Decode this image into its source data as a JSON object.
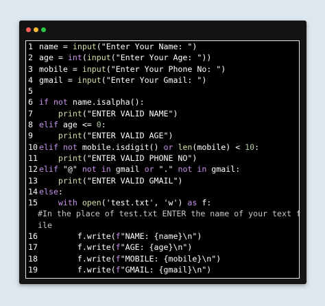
{
  "window": {
    "traffic_colors": [
      "#ff5f57",
      "#febc2e",
      "#28c840"
    ],
    "accent": "#c792ea"
  },
  "lines": [
    {
      "num": "1",
      "tokens": [
        {
          "t": "name = ",
          "c": "txt"
        },
        {
          "t": "input",
          "c": "fn"
        },
        {
          "t": "(\"Enter Your Name: \")",
          "c": "txt"
        }
      ]
    },
    {
      "num": "2",
      "tokens": [
        {
          "t": "age = ",
          "c": "txt"
        },
        {
          "t": "int",
          "c": "kw"
        },
        {
          "t": "(",
          "c": "txt"
        },
        {
          "t": "input",
          "c": "fn"
        },
        {
          "t": "(\"Enter Your Age: \"))",
          "c": "txt"
        }
      ]
    },
    {
      "num": "3",
      "tokens": [
        {
          "t": "mobile = ",
          "c": "txt"
        },
        {
          "t": "input",
          "c": "fn"
        },
        {
          "t": "(\"Enter Your Phone No: \")",
          "c": "txt"
        }
      ]
    },
    {
      "num": "4",
      "tokens": [
        {
          "t": "gmail = ",
          "c": "txt"
        },
        {
          "t": "input",
          "c": "fn"
        },
        {
          "t": "(\"Enter Your Gmail: \")",
          "c": "txt"
        }
      ]
    },
    {
      "num": "5",
      "tokens": []
    },
    {
      "num": "6",
      "tokens": [
        {
          "t": "if not",
          "c": "kw"
        },
        {
          "t": " name.isalpha():",
          "c": "txt"
        }
      ]
    },
    {
      "num": "7",
      "tokens": [
        {
          "t": "    print",
          "c": "fn"
        },
        {
          "t": "(\"ENTER VALID NAME\")",
          "c": "txt"
        }
      ]
    },
    {
      "num": "8",
      "tokens": [
        {
          "t": "elif",
          "c": "kw"
        },
        {
          "t": " age <= ",
          "c": "txt"
        },
        {
          "t": "0",
          "c": "num"
        },
        {
          "t": ":",
          "c": "txt"
        }
      ]
    },
    {
      "num": "9",
      "tokens": [
        {
          "t": "    print",
          "c": "fn"
        },
        {
          "t": "(\"ENTER VALID AGE\")",
          "c": "txt"
        }
      ]
    },
    {
      "num": "10",
      "tokens": [
        {
          "t": "elif not",
          "c": "kw"
        },
        {
          "t": " mobile.isdigit() ",
          "c": "txt"
        },
        {
          "t": "or",
          "c": "kw"
        },
        {
          "t": " ",
          "c": "txt"
        },
        {
          "t": "len",
          "c": "fn"
        },
        {
          "t": "(mobile) < ",
          "c": "txt"
        },
        {
          "t": "10",
          "c": "num"
        },
        {
          "t": ":",
          "c": "txt"
        }
      ]
    },
    {
      "num": "11",
      "tokens": [
        {
          "t": "    print",
          "c": "fn"
        },
        {
          "t": "(\"ENTER VALID PHONE NO\")",
          "c": "txt"
        }
      ]
    },
    {
      "num": "12",
      "tokens": [
        {
          "t": "elif",
          "c": "kw"
        },
        {
          "t": " \"@\" ",
          "c": "txt"
        },
        {
          "t": "not in",
          "c": "kw"
        },
        {
          "t": " gmail ",
          "c": "txt"
        },
        {
          "t": "or",
          "c": "kw"
        },
        {
          "t": " \".\" ",
          "c": "txt"
        },
        {
          "t": "not in",
          "c": "kw"
        },
        {
          "t": " gmail:",
          "c": "txt"
        }
      ]
    },
    {
      "num": "13",
      "tokens": [
        {
          "t": "    print",
          "c": "fn"
        },
        {
          "t": "(\"ENTER VALID GMAIL\")",
          "c": "txt"
        }
      ]
    },
    {
      "num": "14",
      "tokens": [
        {
          "t": "else",
          "c": "kw"
        },
        {
          "t": ":",
          "c": "txt"
        }
      ]
    },
    {
      "num": "15",
      "tokens": [
        {
          "t": "    ",
          "c": "txt"
        },
        {
          "t": "with",
          "c": "kw"
        },
        {
          "t": " ",
          "c": "txt"
        },
        {
          "t": "open",
          "c": "fn"
        },
        {
          "t": "('test.txt', 'w') ",
          "c": "txt"
        },
        {
          "t": "as",
          "c": "kw"
        },
        {
          "t": " f:",
          "c": "txt"
        }
      ]
    },
    {
      "num": "",
      "comment": "#In the place of test.txt ENTER the name of your text f"
    },
    {
      "num": "",
      "comment": "ile"
    },
    {
      "num": "16",
      "tokens": [
        {
          "t": "        f.write(",
          "c": "txt"
        },
        {
          "t": "f",
          "c": "kw"
        },
        {
          "t": "\"NAME: {name}\\n\")",
          "c": "txt"
        }
      ]
    },
    {
      "num": "17",
      "tokens": [
        {
          "t": "        f.write(",
          "c": "txt"
        },
        {
          "t": "f",
          "c": "kw"
        },
        {
          "t": "\"AGE: {age}\\n\")",
          "c": "txt"
        }
      ]
    },
    {
      "num": "18",
      "tokens": [
        {
          "t": "        f.write(",
          "c": "txt"
        },
        {
          "t": "f",
          "c": "kw"
        },
        {
          "t": "\"MOBILE: {mobile}\\n\")",
          "c": "txt"
        }
      ]
    },
    {
      "num": "19",
      "tokens": [
        {
          "t": "        f.write(",
          "c": "txt"
        },
        {
          "t": "f",
          "c": "kw"
        },
        {
          "t": "\"GMAIL: {gmail}\\n\")",
          "c": "txt"
        }
      ]
    }
  ]
}
